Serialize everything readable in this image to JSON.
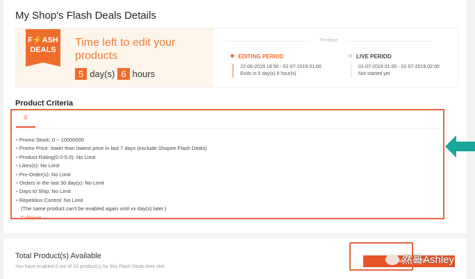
{
  "title": "My Shop's Flash Deals Details",
  "banner": {
    "logo_line1": "F⚡ASH",
    "logo_line2": "DEALS",
    "heading": "Time left to edit your products",
    "days": "5",
    "days_label": "day(s)",
    "hours": "6",
    "hours_label": "hours"
  },
  "timeline": {
    "label": "Timeline",
    "editing": {
      "title": "EDITING PERIOD",
      "range": "22-06-2019 18:56 - 01-07-2019 01:00",
      "status": "Ends in 5 day(s) 6 hour(s)"
    },
    "live": {
      "title": "LIVE PERIOD",
      "range": "01-07-2019 01:00 - 01-07-2019 02:00",
      "status": "Not started yet"
    }
  },
  "criteria": {
    "title": "Product Criteria",
    "tab": "0",
    "items": [
      "Promo Stock: 0 ~ 10000000",
      "Promo Price: lower than lowest price in last 7 days (exclude Shopee Flash Deals)",
      "Product Rating(0.0-5.0): No Limit",
      "Likes(s): No Limit",
      "Pre-Order(s): No Limit",
      "Orders in the last 30 day(s): No Limit",
      "Days to Ship: No Limit",
      "Repetition Control: No Limit"
    ],
    "note": "(The same product can't be enabled again until xx day(s) later.)",
    "collapse": "Collapse"
  },
  "products": {
    "title": "Total Product(s) Available",
    "subtitle": "You have enabled 0 out of 10 product(s) for this Flash Deals time slot.",
    "add_button": "Add Products"
  },
  "watermark": "然哥Ashley",
  "colors": {
    "accent": "#ee4d2d",
    "highlight": "#e8633a",
    "arrow": "#1aa79a"
  }
}
